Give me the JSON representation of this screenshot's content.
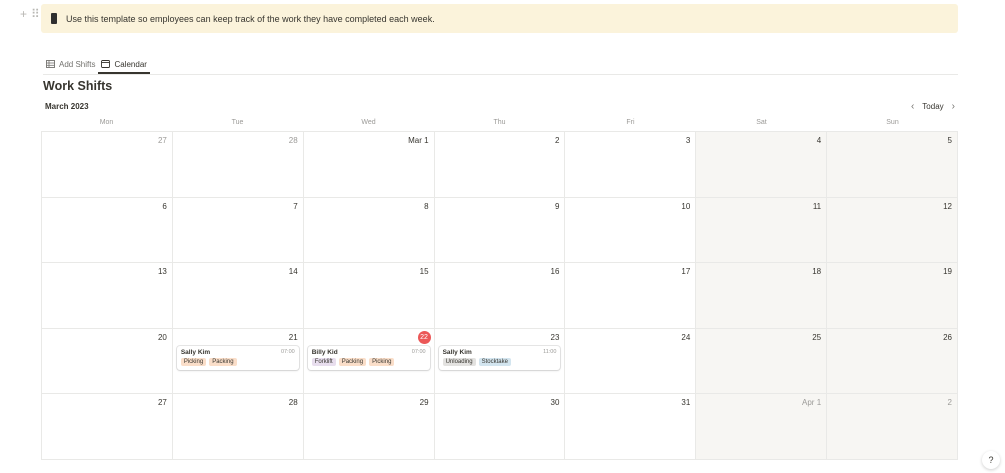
{
  "callout": {
    "text": "Use this template so employees can keep track of the work they have completed each week."
  },
  "tabs": [
    {
      "label": "Add Shifts",
      "icon": "table-icon"
    },
    {
      "label": "Calendar",
      "icon": "calendar-icon"
    }
  ],
  "active_tab": 1,
  "title": "Work Shifts",
  "month_label": "March 2023",
  "nav": {
    "today_label": "Today",
    "prev": "‹",
    "next": "›"
  },
  "weekdays": [
    "Mon",
    "Tue",
    "Wed",
    "Thu",
    "Fri",
    "Sat",
    "Sun"
  ],
  "weeks": [
    [
      "27",
      "28",
      "Mar 1",
      "2",
      "3",
      "4",
      "5"
    ],
    [
      "6",
      "7",
      "8",
      "9",
      "10",
      "11",
      "12"
    ],
    [
      "13",
      "14",
      "15",
      "16",
      "17",
      "18",
      "19"
    ],
    [
      "20",
      "21",
      "22",
      "23",
      "24",
      "25",
      "26"
    ],
    [
      "27",
      "28",
      "29",
      "30",
      "31",
      "Apr 1",
      "2"
    ]
  ],
  "muted_cells": [
    "0-0",
    "0-1",
    "4-5",
    "4-6"
  ],
  "today_cell": "3-2",
  "shifts": [
    {
      "cell": "3-1",
      "name": "Sally Kim",
      "time": "07:00",
      "tags": [
        "Picking",
        "Packing"
      ]
    },
    {
      "cell": "3-2",
      "name": "Billy Kid",
      "time": "07:00",
      "tags": [
        "Forklift",
        "Packing",
        "Picking"
      ]
    },
    {
      "cell": "3-3",
      "name": "Sally Kim",
      "time": "11:00",
      "tags": [
        "Unloading",
        "Stocktake"
      ]
    }
  ],
  "tag_colors": {
    "Picking": "#fadec9",
    "Packing": "#fadec9",
    "Forklift": "#e8deee",
    "Unloading": "#e3e2e0",
    "Stocktake": "#d3e5ef"
  },
  "help": {
    "label": "?"
  }
}
